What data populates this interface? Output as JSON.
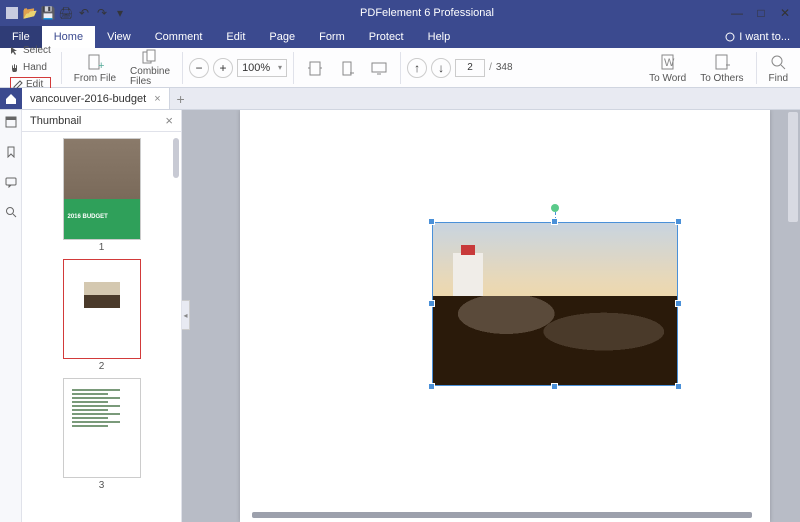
{
  "app": {
    "title": "PDFelement 6 Professional"
  },
  "menu": {
    "file": "File",
    "home": "Home",
    "view": "View",
    "comment": "Comment",
    "edit": "Edit",
    "page": "Page",
    "form": "Form",
    "protect": "Protect",
    "help": "Help",
    "iwant": "I want to..."
  },
  "ribbon": {
    "select": "Select",
    "hand": "Hand",
    "edit": "Edit",
    "fromfile": "From File",
    "combine": "Combine\nFiles",
    "zoom": "100%",
    "pagecur": "2",
    "pagesep": "/",
    "pagetot": "348",
    "toword": "To Word",
    "toothers": "To Others",
    "find": "Find"
  },
  "tabs": {
    "doc": "vancouver-2016-budget"
  },
  "panel": {
    "title": "Thumbnail"
  },
  "thumbs": [
    {
      "num": "1",
      "cover": "2016 BUDGET"
    },
    {
      "num": "2"
    },
    {
      "num": "3"
    }
  ]
}
